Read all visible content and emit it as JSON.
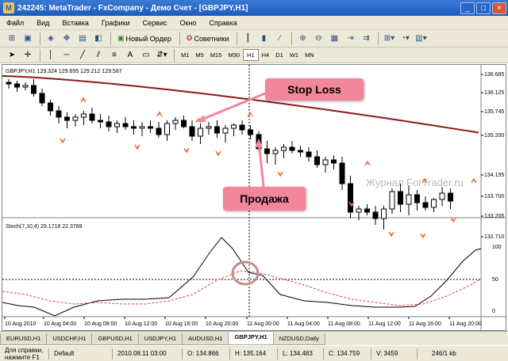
{
  "window": {
    "title": "242245: MetaTrader - FxCompany - Демо Счет - [GBPJPY,H1]",
    "app_icon": "metatrader-icon",
    "buttons": [
      "_",
      "□",
      "×"
    ]
  },
  "menu": [
    "Файл",
    "Вид",
    "Вставка",
    "Графики",
    "Сервис",
    "Окно",
    "Справка"
  ],
  "toolbar1": {
    "new_order": "Новый Ордер",
    "advisors": "Советники",
    "icons": [
      "new-chart-icon",
      "profiles-icon",
      "market-watch-icon",
      "navigator-icon",
      "terminal-icon",
      "strategy-tester-icon",
      "new-order-icon",
      "experts-icon",
      "bar-chart-icon",
      "candles-icon",
      "line-chart-icon",
      "zoom-in-icon",
      "zoom-out-icon",
      "tile-windows-icon",
      "chart-shift-icon",
      "autoscroll-icon",
      "indicators-icon",
      "periods-icon",
      "templates-icon"
    ]
  },
  "toolbar2": {
    "tools": [
      "cursor-icon",
      "crosshair-icon",
      "vertical-line-icon",
      "horizontal-line-icon",
      "trendline-icon",
      "channel-icon",
      "fibonacci-icon",
      "text-icon",
      "label-icon",
      "arrows-icon"
    ],
    "text_tool": "A",
    "timeframes": [
      "M1",
      "M5",
      "M15",
      "M30",
      "H1",
      "H4",
      "D1",
      "W1",
      "MN"
    ],
    "active_timeframe": "H1"
  },
  "chart": {
    "header": "GBPJPY,H1  129.324 129.655 129.212 129.587",
    "price_labels": [
      "136.685",
      "136.125",
      "135.745",
      "135.200",
      "134.195",
      "133.700",
      "133.205",
      "132.710"
    ],
    "time_labels": [
      "10 Aug 2010",
      "10 Aug 04:00",
      "10 Aug 08:00",
      "10 Aug 12:00",
      "10 Aug 16:00",
      "10 Aug 20:00",
      "11 Aug 00:00",
      "11 Aug 04:00",
      "11 Aug 08:00",
      "11 Aug 12:00",
      "11 Aug 16:00",
      "11 Aug 20:00"
    ],
    "watermark": "Журнал ForTrader.ru",
    "stoch_header": "Stoch(7,10,4) 29.1718 22.3789",
    "stoch_labels": [
      "100",
      "50",
      "0"
    ],
    "stop_loss_label": "Stop Loss",
    "sell_label": "Продажа",
    "colors": {
      "ma": "#8b1a1a",
      "stoch_main": "#000000",
      "stoch_signal": "#e0403a",
      "callout": "#f2869a",
      "fractal": "#e8743b"
    }
  },
  "tabs": [
    "EURUSD,H1",
    "USDCHF,H1",
    "GBPUSD,H1",
    "USDJPY,H1",
    "AUDUSD,H1",
    "GBPJPY,H1",
    "NZDUSD,Daily"
  ],
  "active_tab": "GBPJPY,H1",
  "status": {
    "help": "Для справки, нажмите F1",
    "profile": "Default",
    "datetime": "2010.08.11 03:00",
    "open": "O: 134.866",
    "high": "H: 135.164",
    "low": "L: 134.483",
    "close": "C: 134.759",
    "volume": "V: 3459",
    "traffic": "246/1 kb"
  }
}
